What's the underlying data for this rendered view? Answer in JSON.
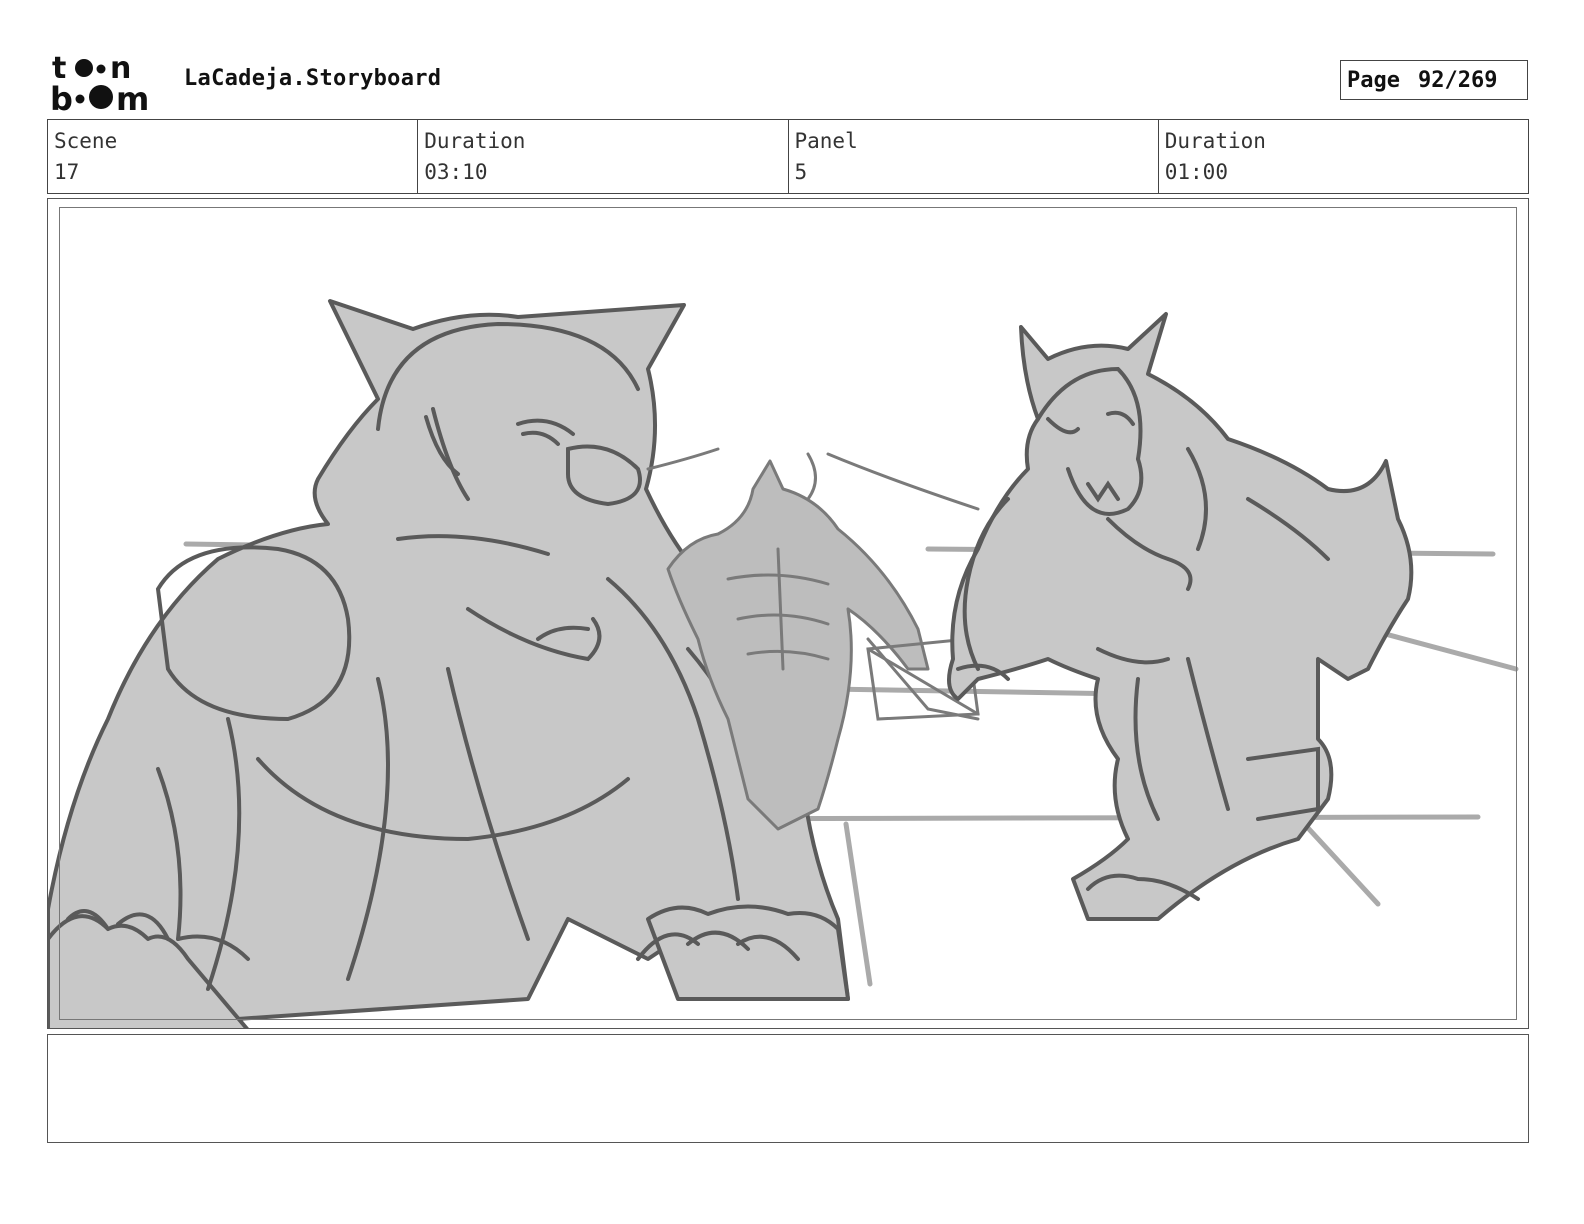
{
  "header": {
    "logo_text": "toon boom",
    "project_title": "LaCadeja.Storyboard",
    "page_label": "Page",
    "page_number": "92/269"
  },
  "info": {
    "scene_label": "Scene",
    "scene_value": "17",
    "scene_duration_label": "Duration",
    "scene_duration_value": "03:10",
    "panel_label": "Panel",
    "panel_value": "5",
    "panel_duration_label": "Duration",
    "panel_duration_value": "01:00"
  },
  "colors": {
    "sketch_fill": "#c8c8c8",
    "sketch_line": "#5a5a5a",
    "sketch_light": "#9a9a9a"
  },
  "notes": {
    "text": ""
  }
}
